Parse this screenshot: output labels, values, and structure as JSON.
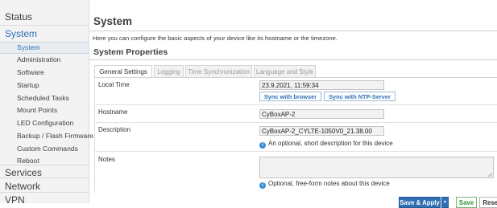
{
  "sidebar": {
    "top_items": [
      {
        "label": "Status"
      },
      {
        "label": "System"
      },
      {
        "label": "Services"
      },
      {
        "label": "Network"
      },
      {
        "label": "VPN"
      }
    ],
    "sub_items": [
      {
        "label": "System"
      },
      {
        "label": "Administration"
      },
      {
        "label": "Software"
      },
      {
        "label": "Startup"
      },
      {
        "label": "Scheduled Tasks"
      },
      {
        "label": "Mount Points"
      },
      {
        "label": "LED Configuration"
      },
      {
        "label": "Backup / Flash Firmware"
      },
      {
        "label": "Custom Commands"
      },
      {
        "label": "Reboot"
      }
    ]
  },
  "page": {
    "title": "System",
    "description": "Here you can configure the basic aspects of your device like its hostname or the timezone.",
    "section_title": "System Properties"
  },
  "tabs": [
    {
      "label": "General Settings"
    },
    {
      "label": "Logging"
    },
    {
      "label": "Time Synchronization"
    },
    {
      "label": "Language and Style"
    }
  ],
  "form": {
    "local_time": {
      "label": "Local Time",
      "value": "23.9.2021, 11:59:34",
      "sync_browser_label": "Sync with browser",
      "sync_ntp_label": "Sync with NTP-Server"
    },
    "hostname": {
      "label": "Hostname",
      "value": "CyBoxAP-2"
    },
    "description": {
      "label": "Description",
      "value": "CyBoxAP-2_CYLTE-1050V0_21.38.00",
      "help": "An optional, short description for this device"
    },
    "notes": {
      "label": "Notes",
      "value": "",
      "help": "Optional, free-form notes about this device"
    }
  },
  "actions": {
    "save_apply_label": "Save & Apply",
    "dropdown_label": "▾",
    "save_label": "Save",
    "reset_label": "Reset"
  },
  "colors": {
    "accent": "#2f6fb6",
    "save_green": "#2c8f2c",
    "info_icon": "#3a8fd6"
  }
}
